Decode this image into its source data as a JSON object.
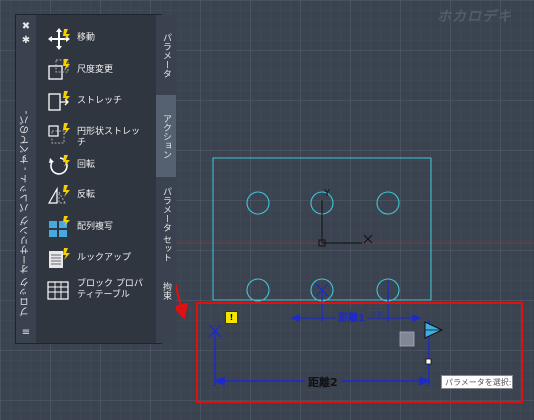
{
  "watermark": "ホカロデキ",
  "palette": {
    "title": "ブロック オーサリング パレット - すべてのパレット",
    "controls": [
      "✖",
      "✱",
      "≡"
    ],
    "tools": [
      {
        "label": "移動",
        "icon": "move-icon"
      },
      {
        "label": "尺度変更",
        "icon": "scale-icon"
      },
      {
        "label": "ストレッチ",
        "icon": "stretch-icon"
      },
      {
        "label": "円形状ストレッチ",
        "icon": "polar-stretch-icon"
      },
      {
        "label": "回転",
        "icon": "rotate-icon"
      },
      {
        "label": "反転",
        "icon": "flip-icon"
      },
      {
        "label": "配列複写",
        "icon": "array-icon"
      },
      {
        "label": "ルックアップ",
        "icon": "lookup-icon"
      },
      {
        "label": "ブロック プロパ\nティテーブル",
        "icon": "block-table-icon"
      }
    ],
    "tabs": [
      "パラメータ",
      "アクション",
      "パラメータ セット",
      "拘束"
    ]
  },
  "drawing": {
    "y_label": "Y",
    "x_mark": "X",
    "dim1_label": "距離1",
    "dim1_count": "1 8",
    "dim2_label": "距離2",
    "tooltip": "パラメータを選択:"
  },
  "colors": {
    "highlight": "#e01010",
    "cyan": "#3cc8d8",
    "dim_blue": "#1a2ad0",
    "grid": "#525c6b"
  }
}
